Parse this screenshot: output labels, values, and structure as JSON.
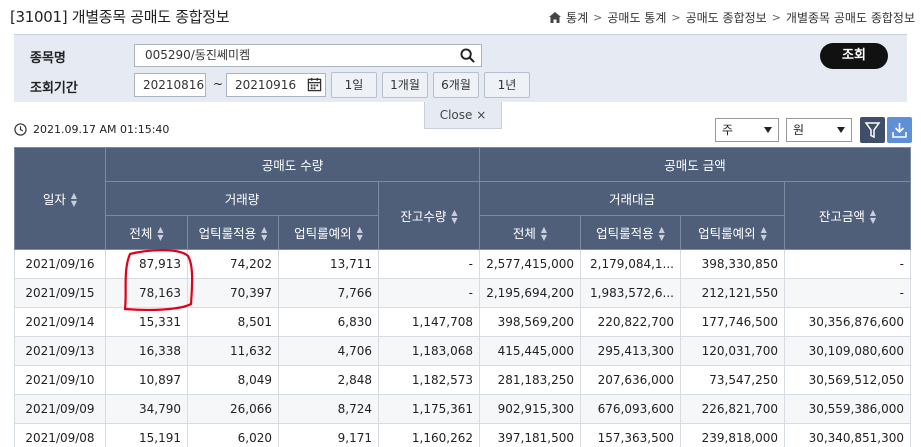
{
  "header": {
    "title": "[31001] 개별종목 공매도 종합정보",
    "breadcrumb": [
      "통계",
      "공매도 통계",
      "공매도 종합정보",
      "개별종목 공매도 종합정보"
    ]
  },
  "search": {
    "stock_label": "종목명",
    "stock_value": "005290/동진쎄미켐",
    "period_label": "조회기간",
    "date_from": "20210816",
    "date_sep": "~",
    "date_to": "20210916",
    "period_buttons": [
      "1일",
      "1개월",
      "6개월",
      "1년"
    ],
    "submit_label": "조회",
    "close_label": "Close ×"
  },
  "toolbar": {
    "timestamp": "2021.09.17 AM 01:15:40",
    "unit_qty": "주",
    "unit_amt": "원"
  },
  "table": {
    "headers": {
      "date": "일자",
      "qty_group": "공매도 수량",
      "amt_group": "공매도 금액",
      "trade_volume": "거래량",
      "trade_value": "거래대금",
      "balance_qty": "잔고수량",
      "balance_amt": "잔고금액",
      "total": "전체",
      "uptick_applied": "업틱룰적용",
      "uptick_exempt": "업틱룰예외"
    },
    "rows": [
      [
        "2021/09/16",
        "87,913",
        "74,202",
        "13,711",
        "-",
        "2,577,415,000",
        "2,179,084,1...",
        "398,330,850",
        "-"
      ],
      [
        "2021/09/15",
        "78,163",
        "70,397",
        "7,766",
        "-",
        "2,195,694,200",
        "1,983,572,6...",
        "212,121,550",
        "-"
      ],
      [
        "2021/09/14",
        "15,331",
        "8,501",
        "6,830",
        "1,147,708",
        "398,569,200",
        "220,822,700",
        "177,746,500",
        "30,356,876,600"
      ],
      [
        "2021/09/13",
        "16,338",
        "11,632",
        "4,706",
        "1,183,068",
        "415,445,000",
        "295,413,300",
        "120,031,700",
        "30,109,080,600"
      ],
      [
        "2021/09/10",
        "10,897",
        "8,049",
        "2,848",
        "1,182,573",
        "281,183,250",
        "207,636,000",
        "73,547,250",
        "30,569,512,050"
      ],
      [
        "2021/09/09",
        "34,790",
        "26,066",
        "8,724",
        "1,175,361",
        "902,915,300",
        "676,093,600",
        "226,821,700",
        "30,559,386,000"
      ],
      [
        "2021/09/08",
        "15,191",
        "6,020",
        "9,171",
        "1,160,262",
        "397,181,500",
        "157,363,500",
        "239,818,000",
        "30,340,851,300"
      ]
    ]
  },
  "colors": {
    "header_bg": "#4f5f7a",
    "panel_bg": "#e6ebf3",
    "annotation": "#e0001b"
  }
}
